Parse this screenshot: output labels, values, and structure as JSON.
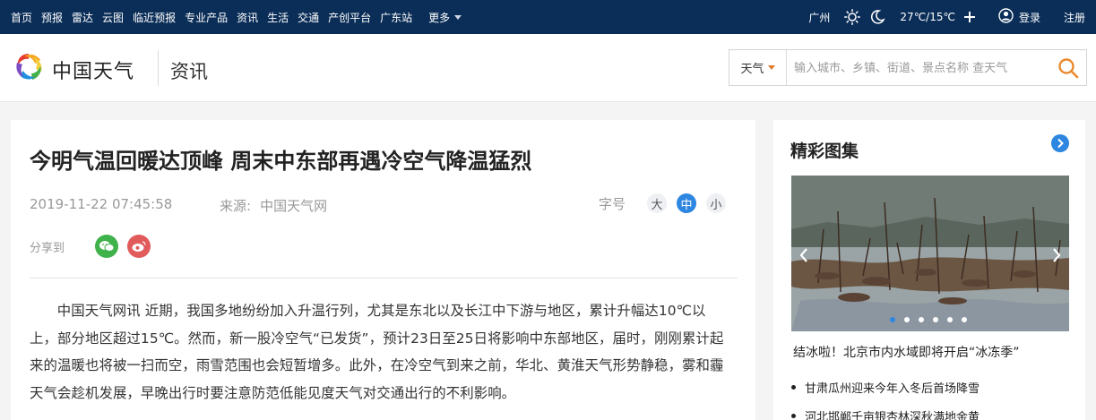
{
  "topbar": {
    "nav": [
      "首页",
      "预报",
      "雷达",
      "云图",
      "临近预报",
      "专业产品",
      "资讯",
      "生活",
      "交通",
      "产创平台",
      "广东站"
    ],
    "more": "更多",
    "city": "广州",
    "temp": "27℃/15℃",
    "login": "登录",
    "register": "注册",
    "icons": [
      "sun-icon",
      "moon-icon",
      "plus-icon",
      "user-icon"
    ]
  },
  "header": {
    "site_name": "中国天气",
    "section": "资讯",
    "search": {
      "selector": "天气",
      "placeholder": "输入城市、乡镇、街道、景点名称 查天气"
    }
  },
  "article": {
    "title": "今明气温回暖达顶峰 周末中东部再遇冷空气降温猛烈",
    "datetime": "2019-11-22 07:45:58",
    "source_label": "来源:",
    "source": "中国天气网",
    "font_size_label": "字号",
    "font_sizes": [
      "大",
      "中",
      "小"
    ],
    "font_size_selected": "中",
    "share_label": "分享到",
    "body": "中国天气网讯 近期，我国多地纷纷加入升温行列，尤其是东北以及长江中下游与地区，累计升幅达10℃以上，部分地区超过15℃。然而，新一股冷空气“已发货”，预计23日至25日将影响中东部地区，届时，刚刚累计起来的温暖也将被一扫而空，雨雪范围也会短暂增多。此外，在冷空气到来之前，华北、黄淮天气形势静稳，雾和霾天气会趁机发展，早晚出行时要注意防范低能见度天气对交通出行的不利影响。"
  },
  "side": {
    "title": "精彩图集",
    "caption": "结冰啦！北京市内水域即将开启“冰冻季”",
    "list": [
      "甘肃瓜州迎来今年入冬后首场降雪",
      "河北邯郸千亩银杏林深秋满地金黄"
    ],
    "accent": "#2d86e0"
  }
}
